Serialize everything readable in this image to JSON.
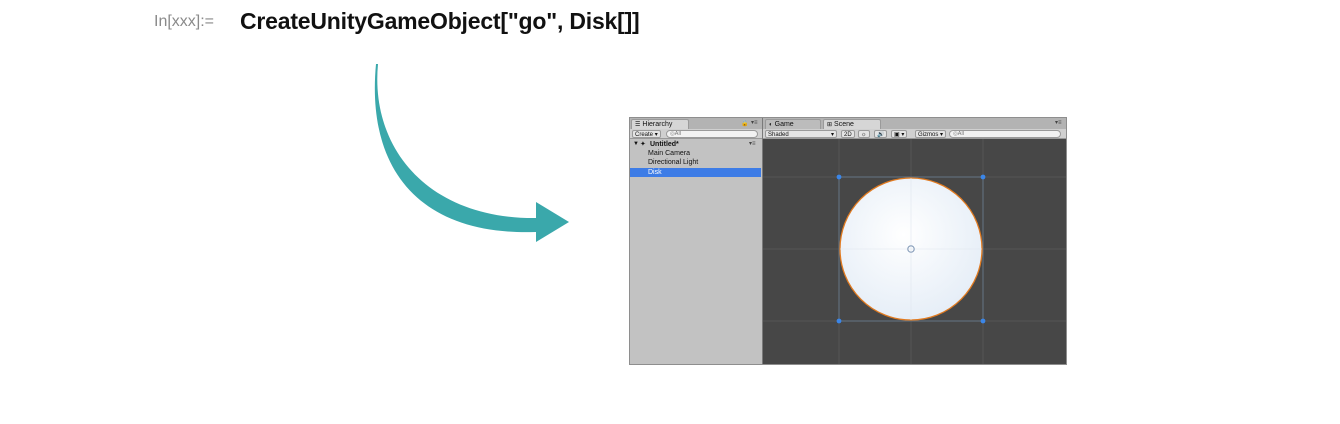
{
  "notebook": {
    "input_label": "In[xxx]:=",
    "input_code": "CreateUnityGameObject[\"go\", Disk[]]"
  },
  "colors": {
    "arrow": "#3aa8ab",
    "selection": "#3d7ce6",
    "scene_bg": "#474747",
    "disk_outline": "#e07a20"
  },
  "unity": {
    "hierarchy": {
      "tab_icon": "list-icon",
      "tab_label": "Hierarchy",
      "create_label": "Create",
      "search_placeholder": "◎All",
      "scene_name": "Untitled*",
      "items": [
        "Main Camera",
        "Directional Light",
        "Disk"
      ],
      "selected_item": "Disk"
    },
    "scene_view": {
      "tabs": [
        {
          "label": "Game",
          "icon": "game-controller-icon",
          "active": false
        },
        {
          "label": "Scene",
          "icon": "grid-icon",
          "active": true
        }
      ],
      "shading_mode": "Shaded",
      "mode_2d": "2D",
      "gizmos_label": "Gizmos",
      "search_placeholder": "◎All",
      "object": "Disk"
    }
  }
}
